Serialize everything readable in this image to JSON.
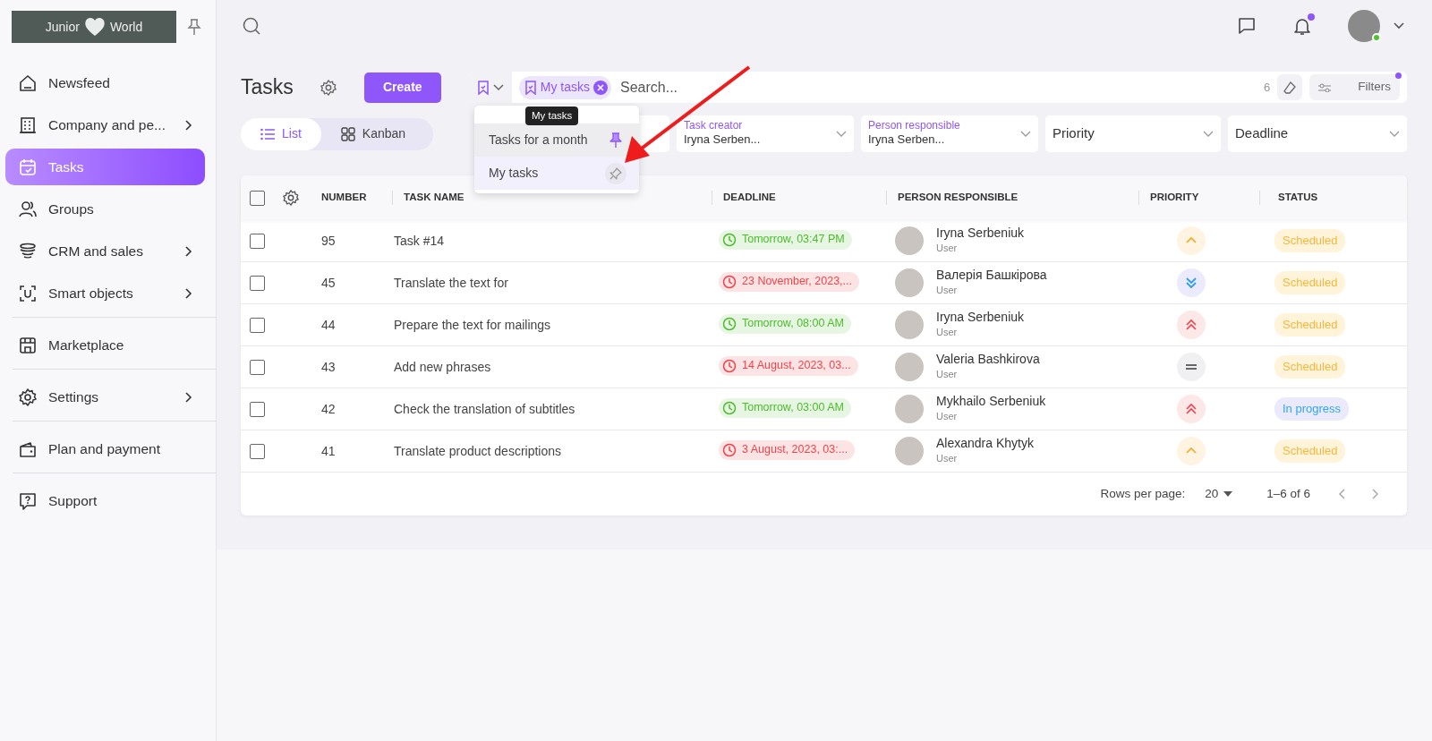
{
  "sidebar": {
    "logo": {
      "left": "Junior",
      "right": "World"
    },
    "groups": [
      {
        "items": [
          {
            "label": "Newsfeed",
            "selected": false,
            "expandable": false
          },
          {
            "label": "Company and pe...",
            "selected": false,
            "expandable": true
          },
          {
            "label": "Tasks",
            "selected": true,
            "expandable": false
          },
          {
            "label": "Groups",
            "selected": false,
            "expandable": false
          },
          {
            "label": "CRM and sales",
            "selected": false,
            "expandable": true
          },
          {
            "label": "Smart objects",
            "selected": false,
            "expandable": true
          }
        ]
      },
      {
        "items": [
          {
            "label": "Marketplace",
            "selected": false,
            "expandable": false
          }
        ]
      },
      {
        "items": [
          {
            "label": "Settings",
            "selected": false,
            "expandable": true
          }
        ]
      },
      {
        "items": [
          {
            "label": "Plan and payment",
            "selected": false,
            "expandable": false
          }
        ]
      },
      {
        "items": [
          {
            "label": "Support",
            "selected": false,
            "expandable": false
          }
        ]
      }
    ]
  },
  "topbar": {
    "notifications_unread": true,
    "user_online": true
  },
  "page": {
    "title": "Tasks",
    "create_button": "Create",
    "views": [
      {
        "label": "List",
        "selected": true
      },
      {
        "label": "Kanban",
        "selected": false
      }
    ]
  },
  "search": {
    "chip": "My tasks",
    "placeholder": "Search...",
    "count": "6",
    "filters_button": "Filters",
    "filters_active": true
  },
  "saved_filters": {
    "items": [
      {
        "label": "Tasks for a month",
        "pinned": true,
        "hovered": true
      },
      {
        "label": "My tasks",
        "pinned": false,
        "hovered": false
      }
    ],
    "tooltip": "My tasks"
  },
  "filters": [
    {
      "label": "Task creator",
      "value": "Iryna Serben..."
    },
    {
      "label": "Person responsible",
      "value": "Iryna Serben..."
    },
    {
      "placeholder": "Priority"
    },
    {
      "placeholder": "Deadline"
    }
  ],
  "table": {
    "all_checked": false,
    "columns": [
      "NUMBER",
      "TASK NAME",
      "DEADLINE",
      "PERSON RESPONSIBLE",
      "PRIORITY",
      "STATUS"
    ],
    "rows": [
      {
        "checked": false,
        "number": "95",
        "name": "Task #14",
        "deadline": "Tomorrow, 03:47 PM",
        "overdue": false,
        "person": "Iryna Serbeniuk",
        "role": "User",
        "priority": {
          "kind": "medium"
        },
        "status": {
          "text": "Scheduled",
          "kind": "scheduled"
        }
      },
      {
        "checked": false,
        "number": "45",
        "name": "Translate the text for",
        "deadline": "23 November, 2023,...",
        "overdue": true,
        "person": "Валерія Башкірова",
        "role": "User",
        "priority": {
          "kind": "low"
        },
        "status": {
          "text": "Scheduled",
          "kind": "scheduled"
        }
      },
      {
        "checked": false,
        "number": "44",
        "name": "Prepare the text for mailings",
        "deadline": "Tomorrow, 08:00 AM",
        "overdue": false,
        "person": "Iryna Serbeniuk",
        "role": "User",
        "priority": {
          "kind": "high"
        },
        "status": {
          "text": "Scheduled",
          "kind": "scheduled"
        }
      },
      {
        "checked": false,
        "number": "43",
        "name": "Add new phrases",
        "deadline": "14 August, 2023, 03...",
        "overdue": true,
        "person": "Valeria Bashkirova",
        "role": "User",
        "priority": {
          "kind": "normal"
        },
        "status": {
          "text": "Scheduled",
          "kind": "scheduled"
        }
      },
      {
        "checked": false,
        "number": "42",
        "name": "Check the translation of subtitles",
        "deadline": "Tomorrow, 03:00 AM",
        "overdue": false,
        "person": "Mykhailo Serbeniuk",
        "role": "User",
        "priority": {
          "kind": "high"
        },
        "status": {
          "text": "In progress",
          "kind": "in_progress"
        }
      },
      {
        "checked": false,
        "number": "41",
        "name": "Translate product descriptions",
        "deadline": "3 August, 2023, 03:...",
        "overdue": true,
        "person": "Alexandra Khytyk",
        "role": "User",
        "priority": {
          "kind": "medium"
        },
        "status": {
          "text": "Scheduled",
          "kind": "scheduled"
        }
      }
    ],
    "footer": {
      "rows_label": "Rows per page:",
      "rows_value": "20",
      "range": "1–6 of 6"
    }
  }
}
